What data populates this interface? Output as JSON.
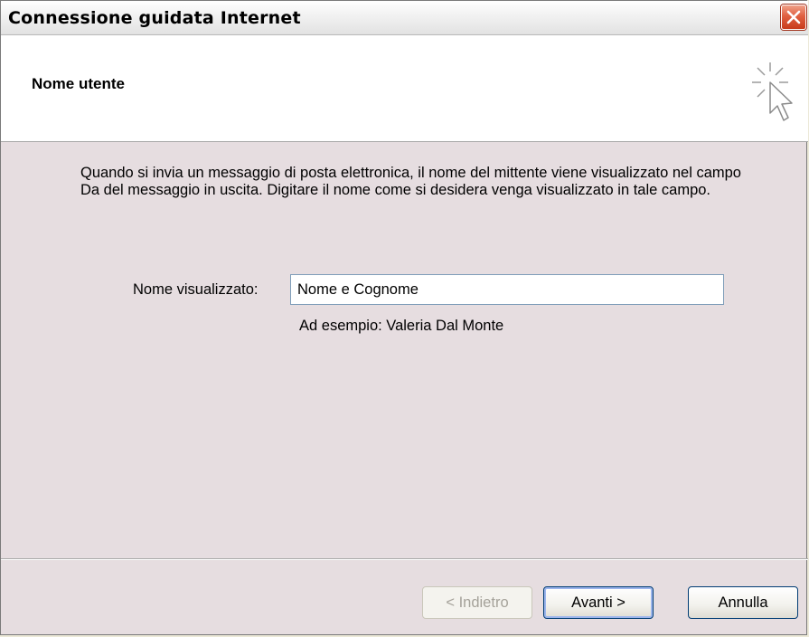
{
  "window": {
    "title": "Connessione guidata Internet"
  },
  "header": {
    "title": "Nome utente",
    "icon": "wizard-cursor-icon"
  },
  "content": {
    "description": "Quando si invia un messaggio di posta elettronica, il nome del mittente viene visualizzato nel campo Da del messaggio in uscita. Digitare il nome come si desidera venga visualizzato in tale campo.",
    "field_label": "Nome visualizzato:",
    "field_value": "Nome e Cognome",
    "example": "Ad esempio: Valeria Dal Monte"
  },
  "buttons": {
    "back": "< Indietro",
    "next": "Avanti >",
    "cancel": "Annulla"
  },
  "colors": {
    "close_button": "#e06040",
    "window_body": "#e6dde0",
    "input_border": "#7f9db9"
  }
}
